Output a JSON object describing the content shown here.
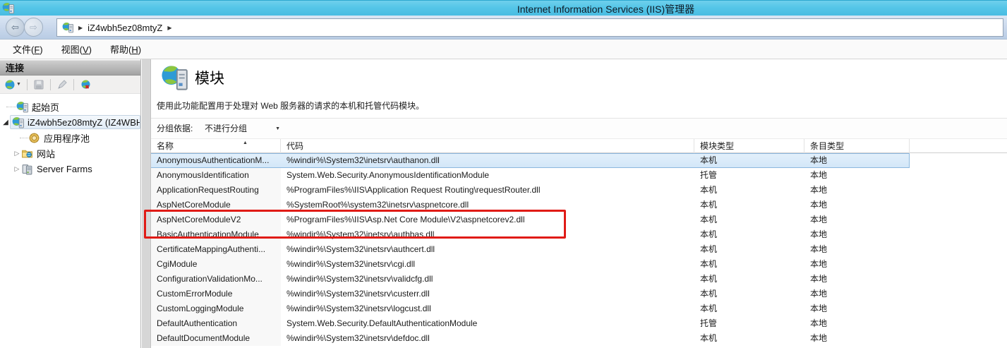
{
  "window": {
    "title": "Internet Information Services (IIS)管理器"
  },
  "navbar": {
    "breadcrumb_server": "iZ4wbh5ez08mtyZ"
  },
  "menubar": {
    "items": [
      {
        "pre": "文件(",
        "key": "F",
        "post": ")"
      },
      {
        "pre": "视图(",
        "key": "V",
        "post": ")"
      },
      {
        "pre": "帮助(",
        "key": "H",
        "post": ")"
      }
    ]
  },
  "sidebar": {
    "header": "连接",
    "tree": [
      {
        "label": "起始页"
      },
      {
        "label": "iZ4wbh5ez08mtyZ (IZ4WBH",
        "selected": true,
        "expanded": true
      },
      {
        "label": "应用程序池"
      },
      {
        "label": "网站",
        "collapsed": true
      },
      {
        "label": "Server Farms",
        "collapsed": true
      }
    ]
  },
  "main": {
    "feature_title": "模块",
    "description": "使用此功能配置用于处理对 Web 服务器的请求的本机和托管代码模块。",
    "group_by_label": "分组依据:",
    "group_by_value": "不进行分组"
  },
  "table": {
    "columns": [
      "名称",
      "代码",
      "模块类型",
      "条目类型"
    ],
    "rows": [
      {
        "name": "AnonymousAuthenticationM...",
        "code": "%windir%\\System32\\inetsrv\\authanon.dll",
        "module_type": "本机",
        "entry_type": "本地",
        "selected": true
      },
      {
        "name": "AnonymousIdentification",
        "code": "System.Web.Security.AnonymousIdentificationModule",
        "module_type": "托管",
        "entry_type": "本地"
      },
      {
        "name": "ApplicationRequestRouting",
        "code": "%ProgramFiles%\\IIS\\Application Request Routing\\requestRouter.dll",
        "module_type": "本机",
        "entry_type": "本地"
      },
      {
        "name": "AspNetCoreModule",
        "code": "%SystemRoot%\\system32\\inetsrv\\aspnetcore.dll",
        "module_type": "本机",
        "entry_type": "本地"
      },
      {
        "name": "AspNetCoreModuleV2",
        "code": "%ProgramFiles%\\IIS\\Asp.Net Core Module\\V2\\aspnetcorev2.dll",
        "module_type": "本机",
        "entry_type": "本地",
        "highlighted": true
      },
      {
        "name": "BasicAuthenticationModule",
        "code": "%windir%\\System32\\inetsrv\\authbas.dll",
        "module_type": "本机",
        "entry_type": "本地"
      },
      {
        "name": "CertificateMappingAuthenti...",
        "code": "%windir%\\System32\\inetsrv\\authcert.dll",
        "module_type": "本机",
        "entry_type": "本地"
      },
      {
        "name": "CgiModule",
        "code": "%windir%\\System32\\inetsrv\\cgi.dll",
        "module_type": "本机",
        "entry_type": "本地"
      },
      {
        "name": "ConfigurationValidationMo...",
        "code": "%windir%\\System32\\inetsrv\\validcfg.dll",
        "module_type": "本机",
        "entry_type": "本地"
      },
      {
        "name": "CustomErrorModule",
        "code": "%windir%\\System32\\inetsrv\\custerr.dll",
        "module_type": "本机",
        "entry_type": "本地"
      },
      {
        "name": "CustomLoggingModule",
        "code": "%windir%\\System32\\inetsrv\\logcust.dll",
        "module_type": "本机",
        "entry_type": "本地"
      },
      {
        "name": "DefaultAuthentication",
        "code": "System.Web.Security.DefaultAuthenticationModule",
        "module_type": "托管",
        "entry_type": "本地"
      },
      {
        "name": "DefaultDocumentModule",
        "code": "%windir%\\System32\\inetsrv\\defdoc.dll",
        "module_type": "本机",
        "entry_type": "本地"
      }
    ]
  },
  "colors": {
    "titlebar_blue": "#55c6e8",
    "selection_blue": "#d2e6f8",
    "selection_border": "#8cb8de",
    "highlight_red": "#e01b16"
  }
}
